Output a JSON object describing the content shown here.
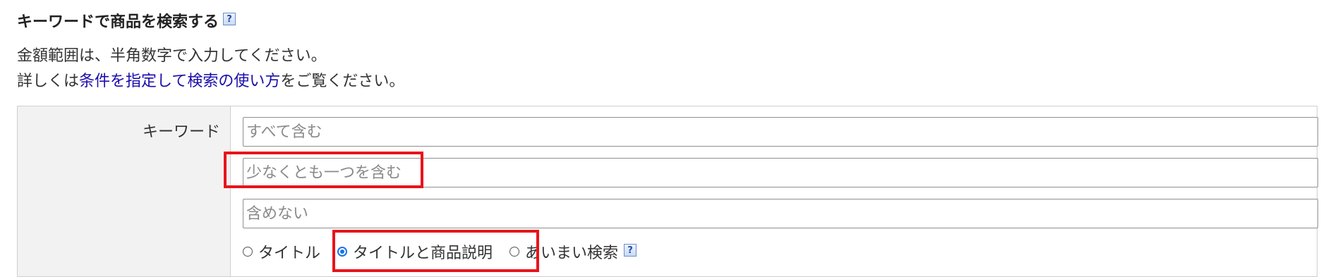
{
  "section": {
    "title": "キーワードで商品を検索する",
    "help_icon": "question-mark-icon",
    "help_symbol": "?"
  },
  "intro": {
    "line1": "金額範囲は、半角数字で入力してください。",
    "line2_prefix": "詳しくは",
    "line2_link": "条件を指定して検索の使い方",
    "line2_suffix": "をご覧ください。",
    "link_color": "#1a0dab"
  },
  "form": {
    "keyword_label": "キーワード",
    "inputs": [
      {
        "placeholder": "すべて含む",
        "value": ""
      },
      {
        "placeholder": "少なくとも一つを含む",
        "value": ""
      },
      {
        "placeholder": "含めない",
        "value": ""
      }
    ],
    "scope_options": [
      {
        "label": "タイトル",
        "selected": false
      },
      {
        "label": "タイトルと商品説明",
        "selected": true
      },
      {
        "label": "あいまい検索",
        "selected": false
      }
    ],
    "scope_help_symbol": "?"
  },
  "colors": {
    "label_bg": "#f2f2f2",
    "border": "#cfcfcf",
    "highlight": "#e8141b",
    "radio_selected": "#1a73e8"
  }
}
